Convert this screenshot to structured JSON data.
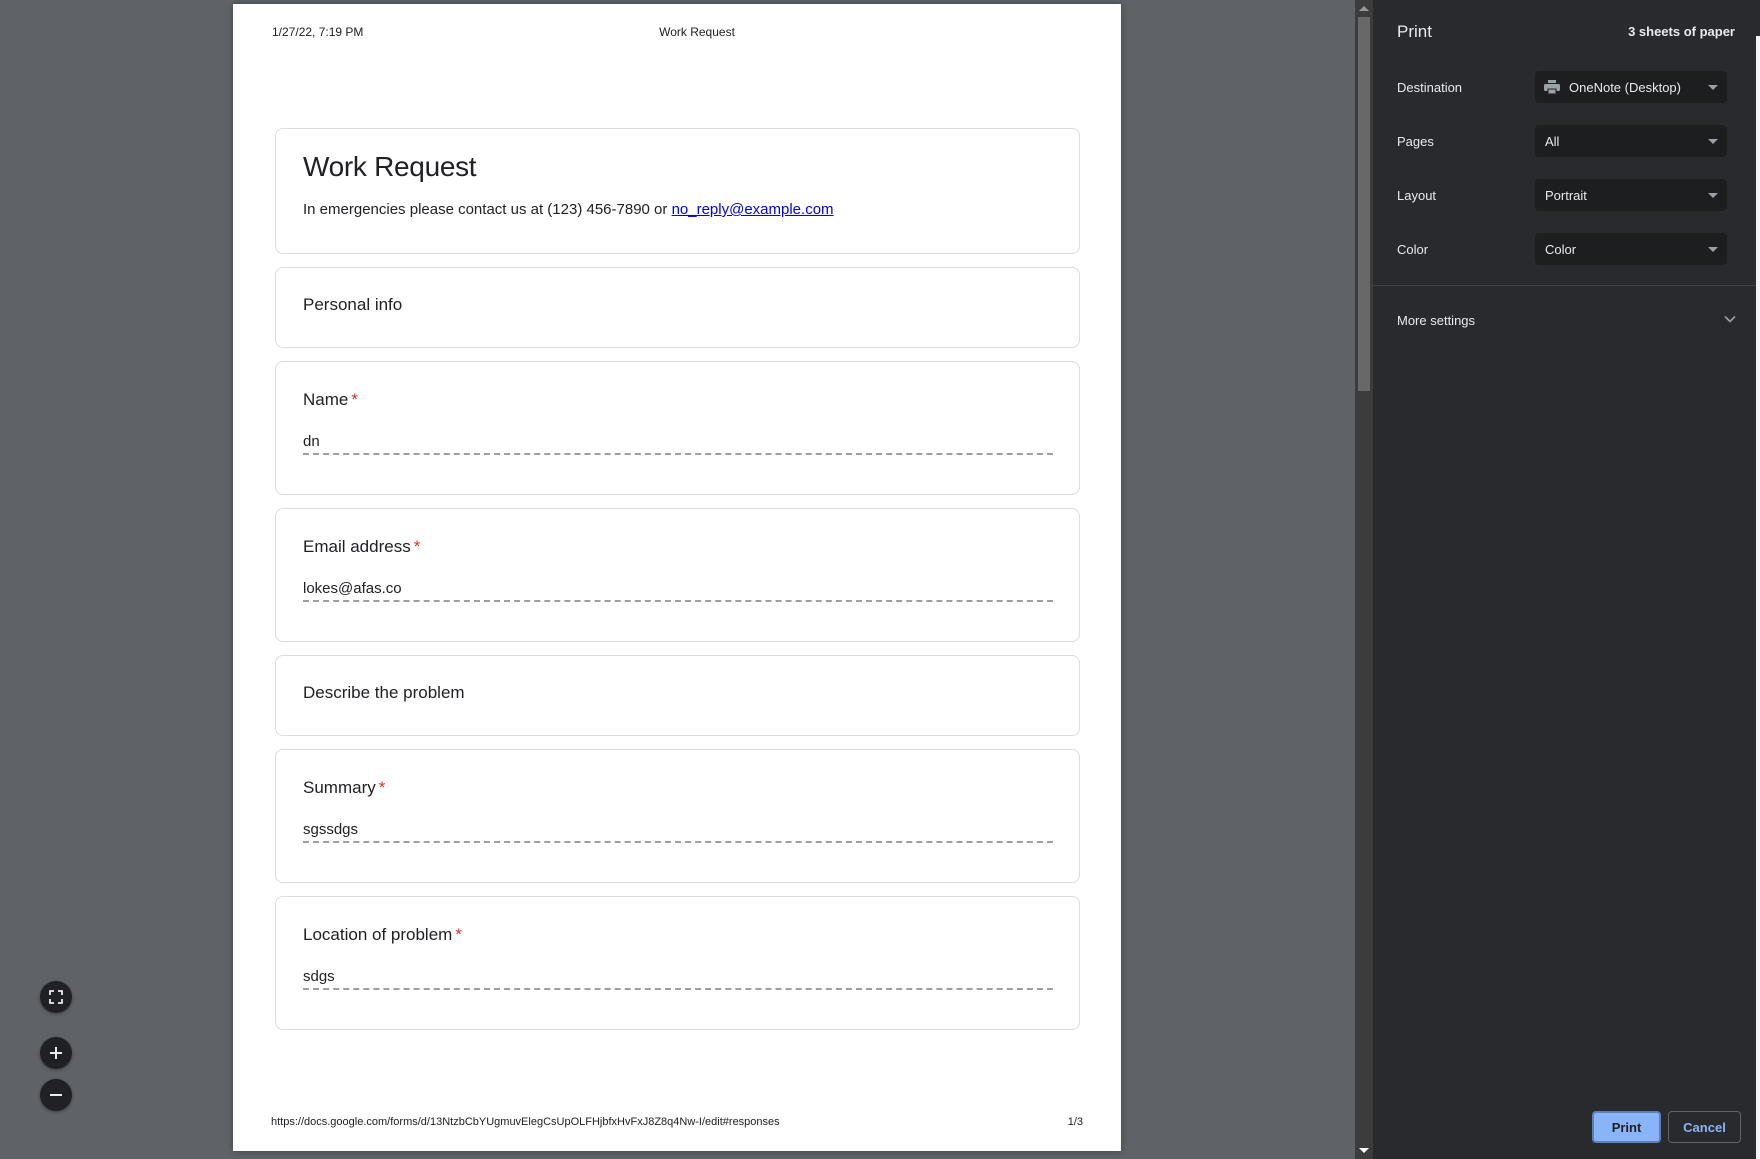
{
  "document": {
    "header": {
      "datetime": "1/27/22, 7:19 PM",
      "title": "Work Request"
    },
    "footer": {
      "url": "https://docs.google.com/forms/d/13NtzbCbYUgmuvElegCsUpOLFHjbfxHvFxJ8Z8q4Nw-I/edit#responses",
      "page_indicator": "1/3"
    },
    "form": {
      "title": "Work Request",
      "description_prefix": "In emergencies please contact us at (123) 456-7890 or ",
      "description_link": "no_reply@example.com",
      "required_marker": "*",
      "sections": [
        {
          "title": "Personal info"
        },
        {
          "title": "Describe the problem"
        }
      ],
      "questions": [
        {
          "label": "Name",
          "answer": "dn",
          "required": true
        },
        {
          "label": "Email address",
          "answer": "lokes@afas.co",
          "required": true
        },
        {
          "label": "Summary",
          "answer": "sgssdgs",
          "required": true
        },
        {
          "label": "Location of problem",
          "answer": "sdgs",
          "required": true
        }
      ]
    }
  },
  "zoom_controls": {
    "fit": "fit-to-page-icon",
    "zoom_in": "zoom-in-icon",
    "zoom_out": "zoom-out-icon"
  },
  "print_panel": {
    "title": "Print",
    "sheets": "3 sheets of paper",
    "settings": [
      {
        "label": "Destination",
        "value": "OneNote (Desktop)",
        "icon": "printer-icon"
      },
      {
        "label": "Pages",
        "value": "All"
      },
      {
        "label": "Layout",
        "value": "Portrait"
      },
      {
        "label": "Color",
        "value": "Color"
      }
    ],
    "more_settings": "More settings",
    "print_button": "Print",
    "cancel_button": "Cancel",
    "colors": {
      "panel_bg": "#292a2d",
      "select_bg": "#1d1e20",
      "accent": "#8ab4f8",
      "required": "#d93025"
    }
  }
}
